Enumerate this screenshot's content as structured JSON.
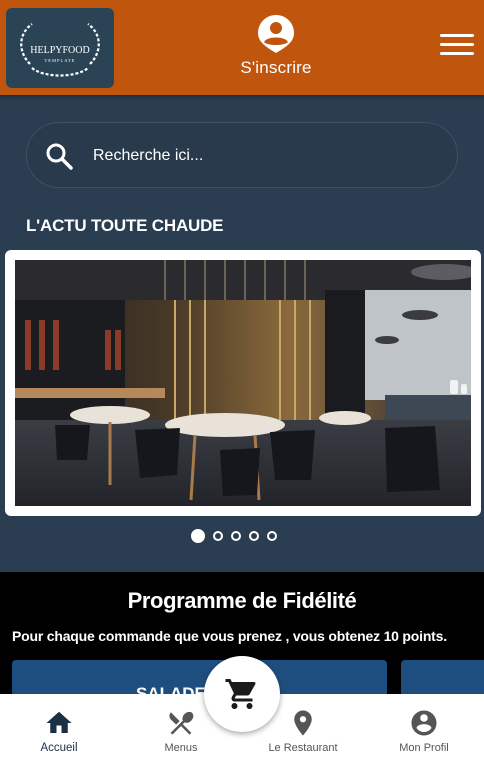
{
  "header": {
    "logo_text": "HELPYFOOD",
    "logo_subtext": "TEMPLATE",
    "signup_label": "S'inscrire",
    "brand_color": "#c0560d"
  },
  "search": {
    "placeholder": "Recherche ici..."
  },
  "news": {
    "title": "L'ACTU TOUTE CHAUDE",
    "slide_count": 5,
    "active_slide": 1
  },
  "fidelity": {
    "title": "Programme de Fidélité",
    "description": "Pour chaque commande que vous prenez , vous obtenez 10 points.",
    "cards": [
      {
        "label": "SALADE"
      },
      {
        "label": ""
      }
    ]
  },
  "bottom_nav": {
    "items": [
      {
        "label": "Accueil",
        "icon": "home-icon",
        "active": true
      },
      {
        "label": "Menus",
        "icon": "cutlery-icon",
        "active": false
      },
      {
        "label": "Le Restaurant",
        "icon": "location-pin-icon",
        "active": false
      },
      {
        "label": "Mon Profil",
        "icon": "account-circle-icon",
        "active": false
      }
    ],
    "cart_icon": "cart-icon"
  }
}
